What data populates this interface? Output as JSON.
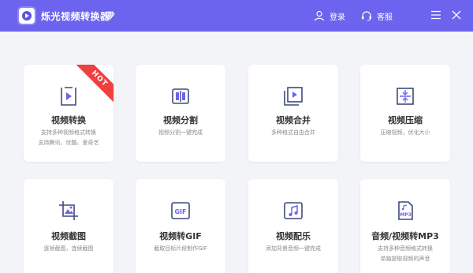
{
  "app": {
    "title": "烁光视频转换器",
    "accent": "#6c63ee",
    "icon_color": "#3d4b78"
  },
  "toolbar": {
    "login_label": "登录",
    "service_label": "客服"
  },
  "cards": [
    {
      "title": "视频转换",
      "desc": [
        "支持多种视频格式转换",
        "支持腾讯、优酷、爱奇艺"
      ],
      "badge": "HOT",
      "icon": "video-play-icon"
    },
    {
      "title": "视频分割",
      "desc": [
        "视频分割一键完成"
      ],
      "icon": "video-split-icon"
    },
    {
      "title": "视频合并",
      "desc": [
        "多种格式自由合并"
      ],
      "icon": "video-merge-icon"
    },
    {
      "title": "视频压缩",
      "desc": [
        "压缩视频，优化大小"
      ],
      "icon": "video-compress-icon"
    },
    {
      "title": "视频截图",
      "desc": [
        "逐帧截图，连续截图"
      ],
      "icon": "screenshot-icon"
    },
    {
      "title": "视频转GIF",
      "desc": [
        "截取目标片段制作GIF"
      ],
      "icon": "gif-icon"
    },
    {
      "title": "视频配乐",
      "desc": [
        "添加背景音频一键完成"
      ],
      "icon": "music-icon"
    },
    {
      "title": "音频/视频转MP3",
      "desc": [
        "支持多种音频格式转换",
        "单独提取视频的声音"
      ],
      "icon": "mp3-icon"
    }
  ]
}
